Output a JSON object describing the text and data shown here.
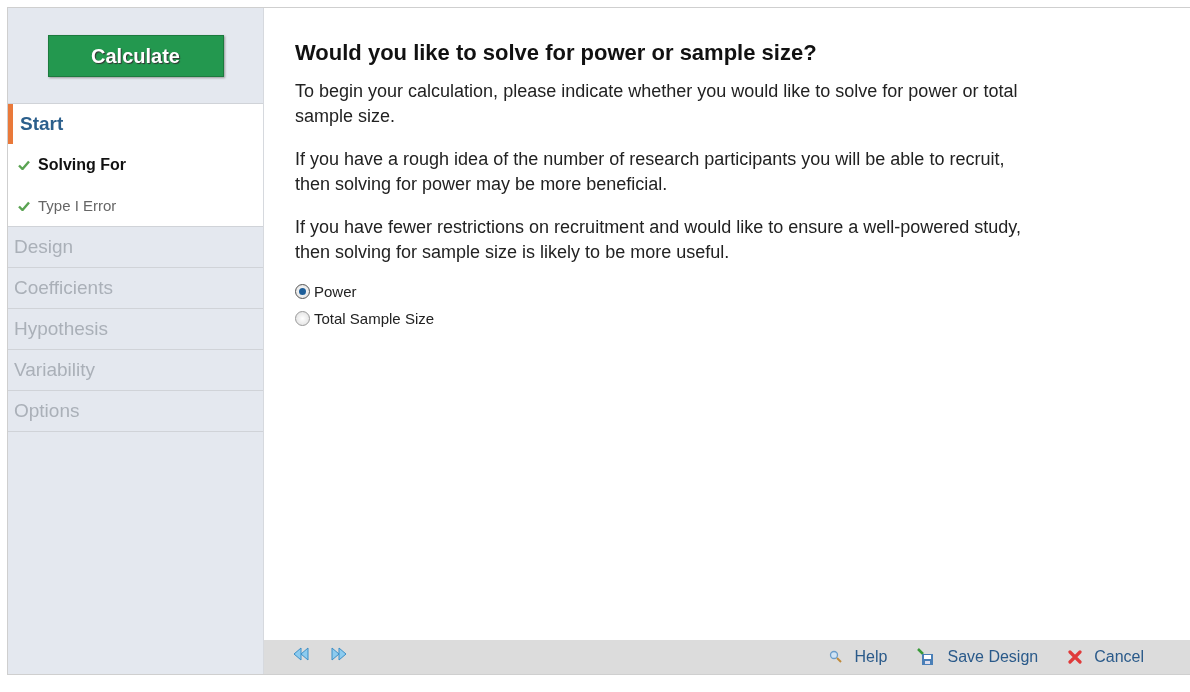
{
  "sidebar": {
    "calculate_button": "Calculate",
    "sections": [
      {
        "label": "Start",
        "selected": true,
        "children": [
          {
            "label": "Solving For",
            "selected": true,
            "checked": true
          },
          {
            "label": "Type I Error",
            "selected": false,
            "checked": true
          }
        ]
      },
      {
        "label": "Design",
        "selected": false
      },
      {
        "label": "Coefficients",
        "selected": false
      },
      {
        "label": "Hypothesis",
        "selected": false
      },
      {
        "label": "Variability",
        "selected": false
      },
      {
        "label": "Options",
        "selected": false
      }
    ]
  },
  "main": {
    "heading": "Would you like to solve for power or sample size?",
    "paragraphs": [
      "To begin your calculation, please indicate whether you would like to solve for power or total sample size.",
      "If you have a rough idea of the number of research participants you will be able to recruit, then solving for power may be more beneficial.",
      "If you have fewer restrictions on recruitment and would like to ensure a well-powered study, then solving for sample size is likely to be more useful."
    ],
    "options": [
      {
        "label": "Power",
        "selected": true
      },
      {
        "label": "Total Sample Size",
        "selected": false
      }
    ]
  },
  "footer": {
    "actions": [
      {
        "kind": "help",
        "label": "Help"
      },
      {
        "kind": "save",
        "label": "Save Design"
      },
      {
        "kind": "cancel",
        "label": "Cancel"
      }
    ]
  }
}
